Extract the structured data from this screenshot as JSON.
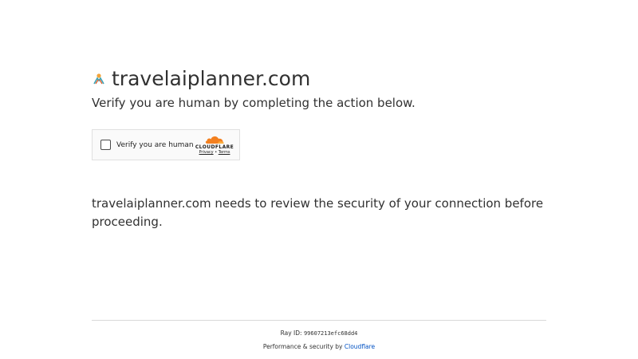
{
  "site": {
    "domain": "travelaiplanner.com",
    "favicon": "travel-planner-favicon-icon"
  },
  "subtitle": "Verify you are human by completing the action below.",
  "widget": {
    "checkbox_label": "Verify you are human",
    "brand": "CLOUDFLARE",
    "privacy_link": "Privacy",
    "separator": "•",
    "terms_link": "Terms",
    "brand_color": "#f38020"
  },
  "description": "travelaiplanner.com needs to review the security of your connection before proceeding.",
  "footer": {
    "ray_label": "Ray ID:",
    "ray_id": "99607213efc68dd4",
    "perf_text": "Performance & security by",
    "perf_link": "Cloudflare",
    "link_color": "#0051c3"
  }
}
